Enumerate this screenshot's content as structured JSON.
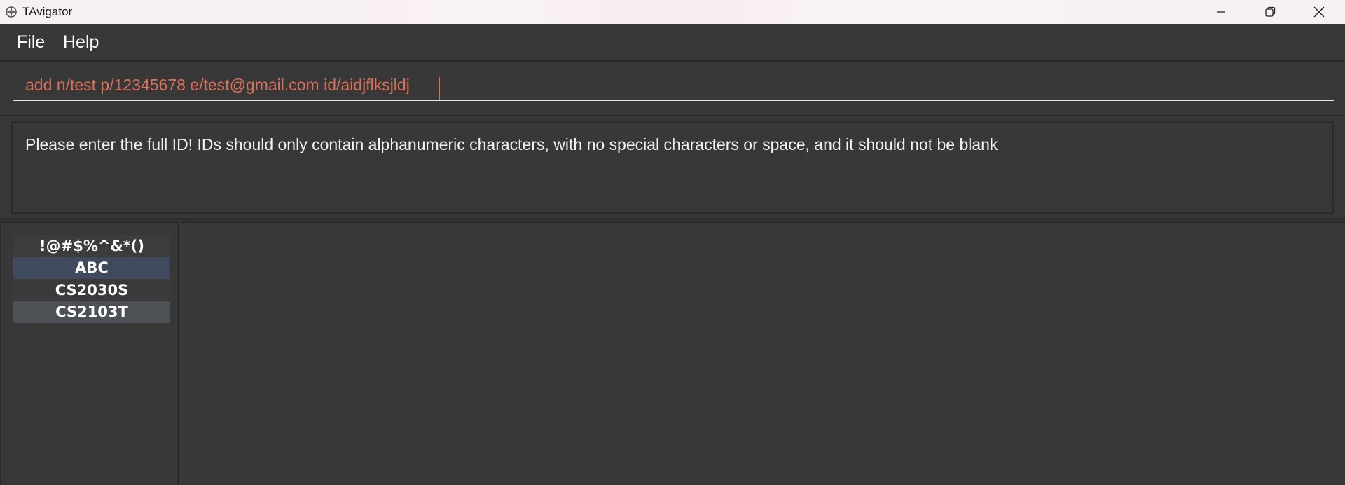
{
  "window": {
    "title": "TAvigator",
    "icon": "compass-icon",
    "controls": [
      "minimize-icon",
      "restore-icon",
      "close-icon"
    ]
  },
  "menu": {
    "file": "File",
    "help": "Help"
  },
  "command": {
    "value": "add n/test p/12345678 e/test@gmail.com id/aidjflksjldj",
    "text_color": "#d9715a"
  },
  "result": {
    "message": "Please enter the full ID! IDs should only contain alphanumeric characters, with no special characters or space, and it should not be blank"
  },
  "course_list": {
    "items": [
      "!@#$%^&*()",
      "ABC",
      "CS2030S",
      "CS2103T"
    ],
    "selected_index": 1,
    "selected_color": "#3f4a5c"
  }
}
